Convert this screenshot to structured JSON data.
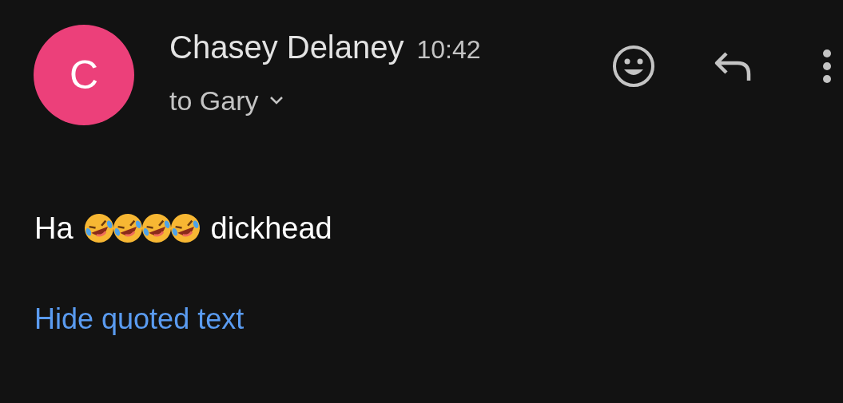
{
  "sender": {
    "initial": "C",
    "name": "Chasey Delaney",
    "time": "10:42",
    "recipients": "to Gary"
  },
  "message": [
    {
      "kind": "text",
      "text": "Ha"
    },
    {
      "kind": "emoji"
    },
    {
      "kind": "emoji"
    },
    {
      "kind": "emoji"
    },
    {
      "kind": "emoji"
    },
    {
      "kind": "text",
      "text": "dickhead"
    }
  ],
  "link": "Hide quoted text"
}
